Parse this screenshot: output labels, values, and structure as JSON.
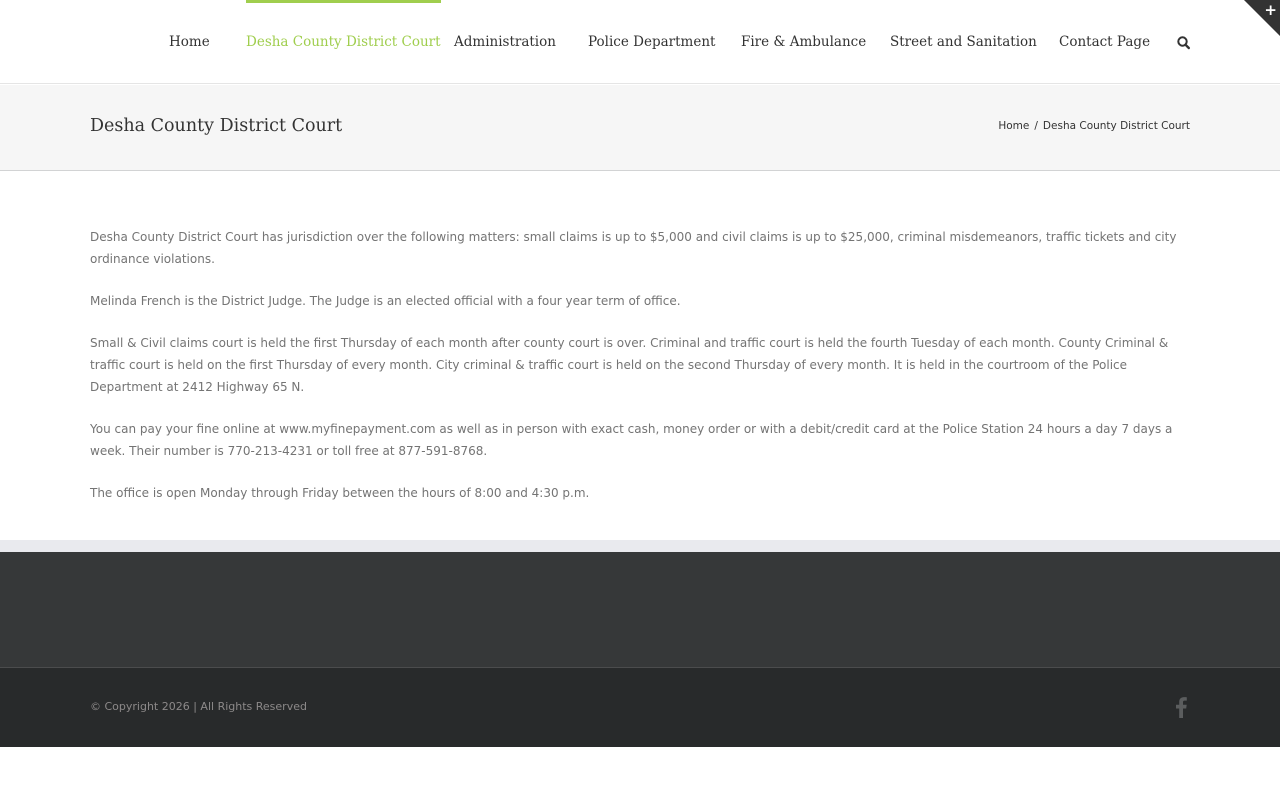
{
  "nav": {
    "items": [
      {
        "label": "Home",
        "active": false
      },
      {
        "label": "Desha County District Court",
        "active": true
      },
      {
        "label": "Administration",
        "active": false
      },
      {
        "label": "Police Department",
        "active": false
      },
      {
        "label": "Fire & Ambulance",
        "active": false
      },
      {
        "label": "Street and Sanitation",
        "active": false
      },
      {
        "label": "Contact Page",
        "active": false
      }
    ],
    "search_icon": "search-icon",
    "corner_toggle": "+"
  },
  "titlebar": {
    "title": "Desha County District Court",
    "breadcrumb": {
      "home": "Home",
      "separator": "/",
      "current": "Desha County District Court"
    }
  },
  "content": {
    "paragraphs": [
      "Desha County District Court has jurisdiction over the following matters: small claims is up to $5,000 and civil claims is up to $25,000, criminal misdemeanors, traffic tickets and city ordinance violations.",
      "Melinda French is the District Judge. The Judge is an elected official with a four year term of office.",
      "Small & Civil claims court is held the first Thursday of each month after county court is over. Criminal and traffic court is held the fourth Tuesday of each month. County Criminal & traffic court is held on the first Thursday of every month.  City criminal & traffic court is held on the second Thursday of every month. It is held in the courtroom of the Police Department at 2412 Highway 65 N.",
      "You can pay your fine online at www.myfinepayment.com as well as in person with exact cash, money order or with a debit/credit card at the Police Station 24 hours a day 7 days a week. Their number is 770-213-4231 or toll free at 877-591-8768.",
      "The office is open Monday through Friday between the hours of 8:00 and 4:30 p.m."
    ]
  },
  "footer": {
    "copyright": "© Copyright 2026 | All Rights Reserved",
    "social_icon": "facebook-icon"
  },
  "colors": {
    "accent": "#a0ce4e",
    "footer_widgets_bg": "#363839",
    "footer_bottom_bg": "#282a2b",
    "titlebar_bg": "#f6f6f6"
  }
}
